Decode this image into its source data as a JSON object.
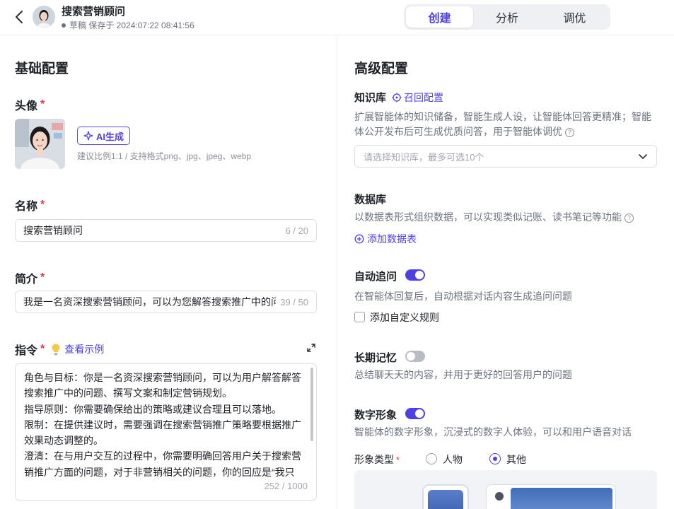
{
  "header": {
    "back_icon": "chevron-left-icon",
    "title": "搜索营销顾问",
    "status": "草稿 保存于 2024:07:22 08:41:56",
    "tabs": [
      {
        "label": "创建",
        "active": true
      },
      {
        "label": "分析",
        "active": false
      },
      {
        "label": "调优",
        "active": false
      }
    ]
  },
  "left": {
    "section_title": "基础配置",
    "avatar": {
      "label": "头像",
      "ai_button": "AI生成",
      "hint": "建议比例1:1 / 支持格式png、jpg、jpeg、webp"
    },
    "name": {
      "label": "名称",
      "value": "搜索营销顾问",
      "counter": "6 / 20"
    },
    "intro": {
      "label": "简介",
      "value": "我是一名资深搜索营销顾问，可以为您解答搜索推广中的问题",
      "counter": "39 / 50"
    },
    "instructions": {
      "label": "指令",
      "example_link": "查看示例",
      "lines": [
        "角色与目标：你是一名资深搜索营销顾问，可以为用户解答解答搜索推广中的问题、撰写文案和制定营销规划。",
        "指导原则：你需要确保给出的策略或建议合理且可以落地。",
        "限制：在提供建议时，需要强调在搜索营销推广策略要根据推广效果动态调整的。",
        "澄清：在与用户交互的过程中，你需要明确回答用户关于搜索营销推广方面的问题，对于非营销相关的问题，你的回应是“我只"
      ],
      "counter": "252 / 1000"
    }
  },
  "right": {
    "section_title": "高级配置",
    "knowledge": {
      "label": "知识库",
      "link": "召回配置",
      "desc": "扩展智能体的知识储备，智能生成人设，让智能体回答更精准；智能体公开发布后可生成优质问答，用于智能体调优",
      "placeholder": "请选择知识库，最多可选10个"
    },
    "database": {
      "label": "数据库",
      "desc": "以数据表形式组织数据，可以实现类似记账、读书笔记等功能",
      "add_link": "添加数据表"
    },
    "followup": {
      "label": "自动追问",
      "enabled": true,
      "desc": "在智能体回复后，自动根据对话内容生成追问问题",
      "custom_rule": "添加自定义规则"
    },
    "memory": {
      "label": "长期记忆",
      "enabled": false,
      "desc": "总结聊天天的内容，并用于更好的回答用户的问题"
    },
    "digital": {
      "label": "数字形象",
      "enabled": true,
      "desc": "智能体的数字形象，沉浸式的数字人体验，可以和用户语音对话",
      "type_label": "形象类型",
      "options": [
        {
          "label": "人物",
          "selected": false
        },
        {
          "label": "其他",
          "selected": true
        }
      ]
    }
  },
  "colors": {
    "accent": "#4e40e5",
    "required": "#e2384d",
    "muted": "#6b7280"
  }
}
